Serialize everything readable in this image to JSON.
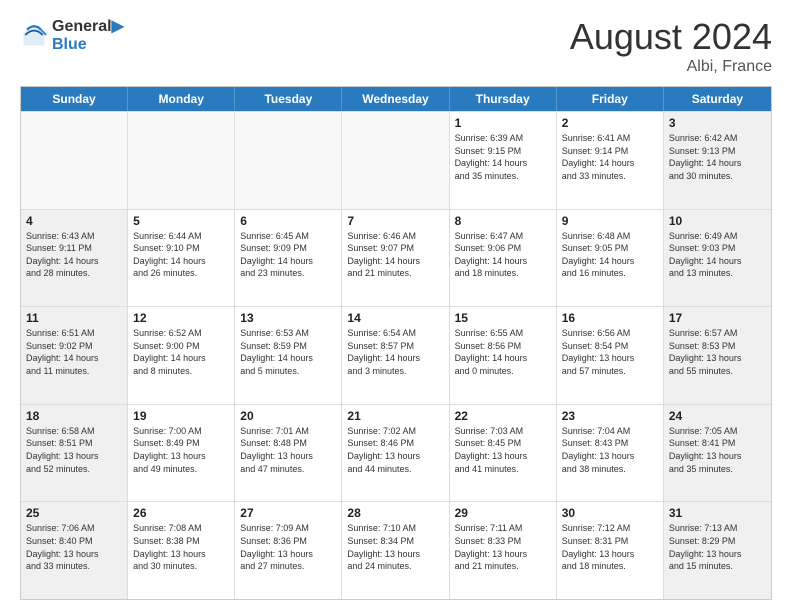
{
  "logo": {
    "line1": "General",
    "line2": "Blue"
  },
  "title": "August 2024",
  "location": "Albi, France",
  "header_days": [
    "Sunday",
    "Monday",
    "Tuesday",
    "Wednesday",
    "Thursday",
    "Friday",
    "Saturday"
  ],
  "rows": [
    [
      {
        "day": "",
        "text": "",
        "empty": true
      },
      {
        "day": "",
        "text": "",
        "empty": true
      },
      {
        "day": "",
        "text": "",
        "empty": true
      },
      {
        "day": "",
        "text": "",
        "empty": true
      },
      {
        "day": "1",
        "text": "Sunrise: 6:39 AM\nSunset: 9:15 PM\nDaylight: 14 hours\nand 35 minutes.",
        "shaded": false
      },
      {
        "day": "2",
        "text": "Sunrise: 6:41 AM\nSunset: 9:14 PM\nDaylight: 14 hours\nand 33 minutes.",
        "shaded": false
      },
      {
        "day": "3",
        "text": "Sunrise: 6:42 AM\nSunset: 9:13 PM\nDaylight: 14 hours\nand 30 minutes.",
        "shaded": true
      }
    ],
    [
      {
        "day": "4",
        "text": "Sunrise: 6:43 AM\nSunset: 9:11 PM\nDaylight: 14 hours\nand 28 minutes.",
        "shaded": true
      },
      {
        "day": "5",
        "text": "Sunrise: 6:44 AM\nSunset: 9:10 PM\nDaylight: 14 hours\nand 26 minutes.",
        "shaded": false
      },
      {
        "day": "6",
        "text": "Sunrise: 6:45 AM\nSunset: 9:09 PM\nDaylight: 14 hours\nand 23 minutes.",
        "shaded": false
      },
      {
        "day": "7",
        "text": "Sunrise: 6:46 AM\nSunset: 9:07 PM\nDaylight: 14 hours\nand 21 minutes.",
        "shaded": false
      },
      {
        "day": "8",
        "text": "Sunrise: 6:47 AM\nSunset: 9:06 PM\nDaylight: 14 hours\nand 18 minutes.",
        "shaded": false
      },
      {
        "day": "9",
        "text": "Sunrise: 6:48 AM\nSunset: 9:05 PM\nDaylight: 14 hours\nand 16 minutes.",
        "shaded": false
      },
      {
        "day": "10",
        "text": "Sunrise: 6:49 AM\nSunset: 9:03 PM\nDaylight: 14 hours\nand 13 minutes.",
        "shaded": true
      }
    ],
    [
      {
        "day": "11",
        "text": "Sunrise: 6:51 AM\nSunset: 9:02 PM\nDaylight: 14 hours\nand 11 minutes.",
        "shaded": true
      },
      {
        "day": "12",
        "text": "Sunrise: 6:52 AM\nSunset: 9:00 PM\nDaylight: 14 hours\nand 8 minutes.",
        "shaded": false
      },
      {
        "day": "13",
        "text": "Sunrise: 6:53 AM\nSunset: 8:59 PM\nDaylight: 14 hours\nand 5 minutes.",
        "shaded": false
      },
      {
        "day": "14",
        "text": "Sunrise: 6:54 AM\nSunset: 8:57 PM\nDaylight: 14 hours\nand 3 minutes.",
        "shaded": false
      },
      {
        "day": "15",
        "text": "Sunrise: 6:55 AM\nSunset: 8:56 PM\nDaylight: 14 hours\nand 0 minutes.",
        "shaded": false
      },
      {
        "day": "16",
        "text": "Sunrise: 6:56 AM\nSunset: 8:54 PM\nDaylight: 13 hours\nand 57 minutes.",
        "shaded": false
      },
      {
        "day": "17",
        "text": "Sunrise: 6:57 AM\nSunset: 8:53 PM\nDaylight: 13 hours\nand 55 minutes.",
        "shaded": true
      }
    ],
    [
      {
        "day": "18",
        "text": "Sunrise: 6:58 AM\nSunset: 8:51 PM\nDaylight: 13 hours\nand 52 minutes.",
        "shaded": true
      },
      {
        "day": "19",
        "text": "Sunrise: 7:00 AM\nSunset: 8:49 PM\nDaylight: 13 hours\nand 49 minutes.",
        "shaded": false
      },
      {
        "day": "20",
        "text": "Sunrise: 7:01 AM\nSunset: 8:48 PM\nDaylight: 13 hours\nand 47 minutes.",
        "shaded": false
      },
      {
        "day": "21",
        "text": "Sunrise: 7:02 AM\nSunset: 8:46 PM\nDaylight: 13 hours\nand 44 minutes.",
        "shaded": false
      },
      {
        "day": "22",
        "text": "Sunrise: 7:03 AM\nSunset: 8:45 PM\nDaylight: 13 hours\nand 41 minutes.",
        "shaded": false
      },
      {
        "day": "23",
        "text": "Sunrise: 7:04 AM\nSunset: 8:43 PM\nDaylight: 13 hours\nand 38 minutes.",
        "shaded": false
      },
      {
        "day": "24",
        "text": "Sunrise: 7:05 AM\nSunset: 8:41 PM\nDaylight: 13 hours\nand 35 minutes.",
        "shaded": true
      }
    ],
    [
      {
        "day": "25",
        "text": "Sunrise: 7:06 AM\nSunset: 8:40 PM\nDaylight: 13 hours\nand 33 minutes.",
        "shaded": true
      },
      {
        "day": "26",
        "text": "Sunrise: 7:08 AM\nSunset: 8:38 PM\nDaylight: 13 hours\nand 30 minutes.",
        "shaded": false
      },
      {
        "day": "27",
        "text": "Sunrise: 7:09 AM\nSunset: 8:36 PM\nDaylight: 13 hours\nand 27 minutes.",
        "shaded": false
      },
      {
        "day": "28",
        "text": "Sunrise: 7:10 AM\nSunset: 8:34 PM\nDaylight: 13 hours\nand 24 minutes.",
        "shaded": false
      },
      {
        "day": "29",
        "text": "Sunrise: 7:11 AM\nSunset: 8:33 PM\nDaylight: 13 hours\nand 21 minutes.",
        "shaded": false
      },
      {
        "day": "30",
        "text": "Sunrise: 7:12 AM\nSunset: 8:31 PM\nDaylight: 13 hours\nand 18 minutes.",
        "shaded": false
      },
      {
        "day": "31",
        "text": "Sunrise: 7:13 AM\nSunset: 8:29 PM\nDaylight: 13 hours\nand 15 minutes.",
        "shaded": true
      }
    ]
  ]
}
